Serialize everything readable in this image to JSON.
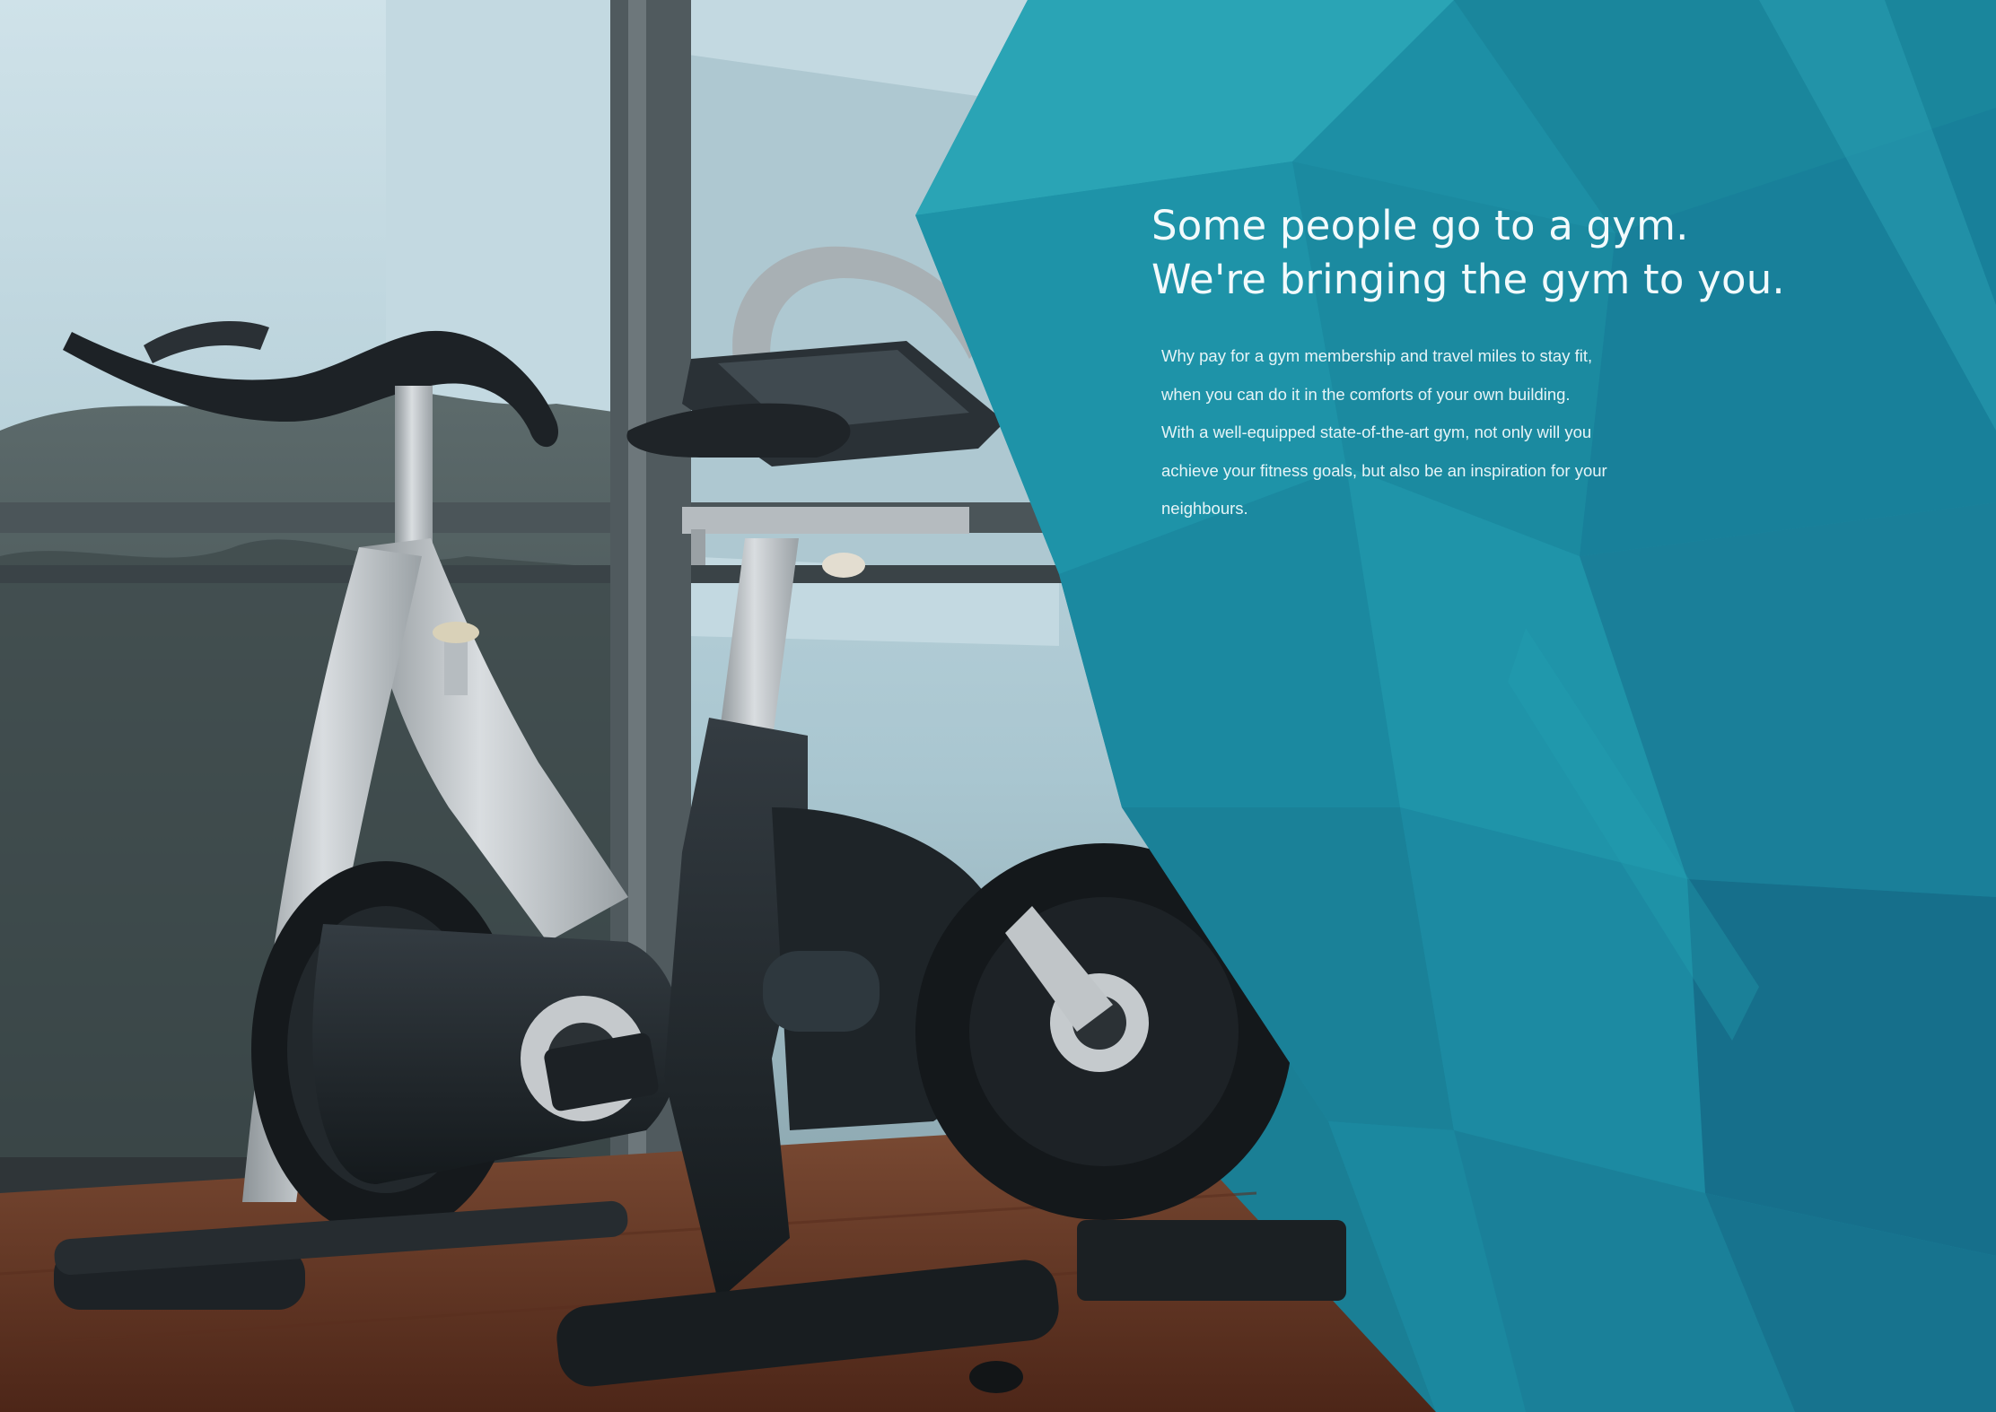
{
  "headline": {
    "line1": "Some people go to a gym.",
    "line2": "We're bringing the gym to you."
  },
  "body": {
    "line1": "Why pay for a gym membership and travel miles to stay fit,",
    "line2": "when you can do it in the comforts of your own building.",
    "line3": "With a well-equipped state-of-the-art gym, not only will you",
    "line4": "achieve your fitness goals, but also be an inspiration for your",
    "line5": "neighbours."
  },
  "colors": {
    "teal_primary": "#1f8ea4",
    "teal_dark": "#166f86",
    "teal_light": "#2aa5b5",
    "floor_wood": "#6a3a26",
    "bike_black": "#1e2429",
    "bike_silver": "#b9bec2",
    "window_sky": "#b9d3dc"
  }
}
